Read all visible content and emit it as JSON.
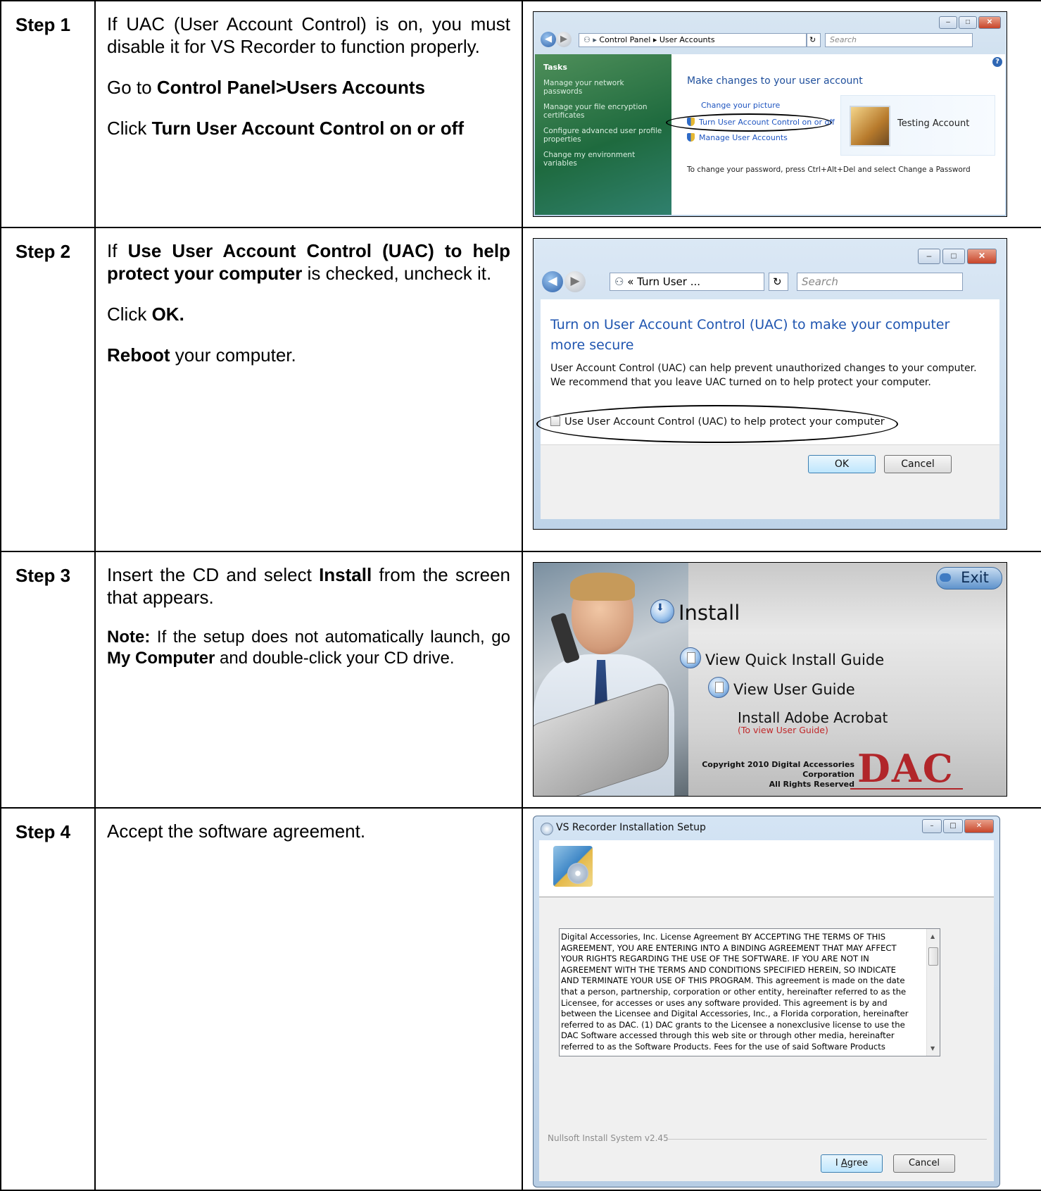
{
  "steps": [
    {
      "label": "Step 1",
      "text": {
        "p1_pre": "If UAC (User Account Control) is on, you must disable it for VS Recorder to function properly.",
        "p2_pre": "Go to ",
        "p2_bold": "Control Panel>Users Accounts",
        "p3_pre": "Click ",
        "p3_bold": "Turn User Account Control on or off"
      },
      "screenshot": {
        "breadcrumb": "Control Panel  ▸  User Accounts",
        "search_placeholder": "Search",
        "tasks_title": "Tasks",
        "tasks": [
          "Manage your network passwords",
          "Manage your file encryption certificates",
          "Configure advanced user profile properties",
          "Change my environment variables"
        ],
        "heading": "Make changes to your user account",
        "links": [
          "Change your picture",
          "Turn User Account Control on or off",
          "Manage User Accounts"
        ],
        "account_name": "Testing Account",
        "password_note": "To change your password, press Ctrl+Alt+Del and select Change a Password"
      }
    },
    {
      "label": "Step 2",
      "text": {
        "p1_a": "If ",
        "p1_bold": "Use User Account Control (UAC) to help protect your computer",
        "p1_b": " is checked, uncheck it.",
        "p2_pre": "Click ",
        "p2_bold": "OK.",
        "p3_bold": "Reboot",
        "p3_post": " your computer."
      },
      "screenshot": {
        "breadcrumb": "«  Turn User ...",
        "search_placeholder": "Search",
        "heading": "Turn on User Account Control (UAC) to make your computer more secure",
        "paragraph": "User Account Control (UAC) can help prevent unauthorized changes to your computer.  We recommend that you leave UAC turned on to help protect your computer.",
        "checkbox_label": "Use User Account Control (UAC) to help protect your computer",
        "checkbox_checked": false,
        "ok_label": "OK",
        "cancel_label": "Cancel"
      }
    },
    {
      "label": "Step 3",
      "text": {
        "p1_a": "Insert the CD and select ",
        "p1_bold": "Install",
        "p1_b": " from the screen that appears.",
        "note_bold": "Note:",
        "note_a": " If the setup does not automatically launch, go ",
        "note_bold2": "My Computer",
        "note_b": " and double-click your CD drive."
      },
      "screenshot": {
        "exit_label": "Exit",
        "install_label": "Install",
        "quick_guide_label": "View Quick Install Guide",
        "user_guide_label": "View User Guide",
        "acrobat_label": "Install Adobe Acrobat",
        "acrobat_sub": "(To view User Guide)",
        "copyright_1": "Copyright 2010 Digital Accessories Corporation",
        "copyright_2": "All Rights Reserved",
        "logo_text": "DAC"
      }
    },
    {
      "label": "Step 4",
      "text": {
        "p1": "Accept the software agreement."
      },
      "screenshot": {
        "window_title": "VS Recorder Installation Setup",
        "license_text": "Digital Accessories, Inc. License Agreement BY ACCEPTING THE TERMS OF THIS\nAGREEMENT, YOU ARE ENTERING INTO A BINDING AGREEMENT THAT MAY AFFECT\nYOUR RIGHTS REGARDING THE USE OF THE SOFTWARE. IF YOU ARE NOT IN\nAGREEMENT WITH THE TERMS AND CONDITIONS SPECIFIED HEREIN, SO INDICATE\nAND TERMINATE YOUR USE OF THIS PROGRAM. This agreement is made on the date\nthat a person, partnership, corporation or other entity, hereinafter referred to as the\nLicensee, for accesses or uses any software provided. This agreement is by and\nbetween the Licensee and Digital Accessories, Inc., a Florida corporation, hereinafter\nreferred to as DAC.    (1) DAC grants to the Licensee a nonexclusive license to use the\nDAC Software accessed through this web site or through other media, hereinafter\nreferred to as the Software Products. Fees for the use of said Software Products",
        "branding": "Nullsoft Install System v2.45",
        "agree_pre": "I ",
        "agree_underlined": "A",
        "agree_post": "gree",
        "cancel_label": "Cancel"
      }
    }
  ]
}
